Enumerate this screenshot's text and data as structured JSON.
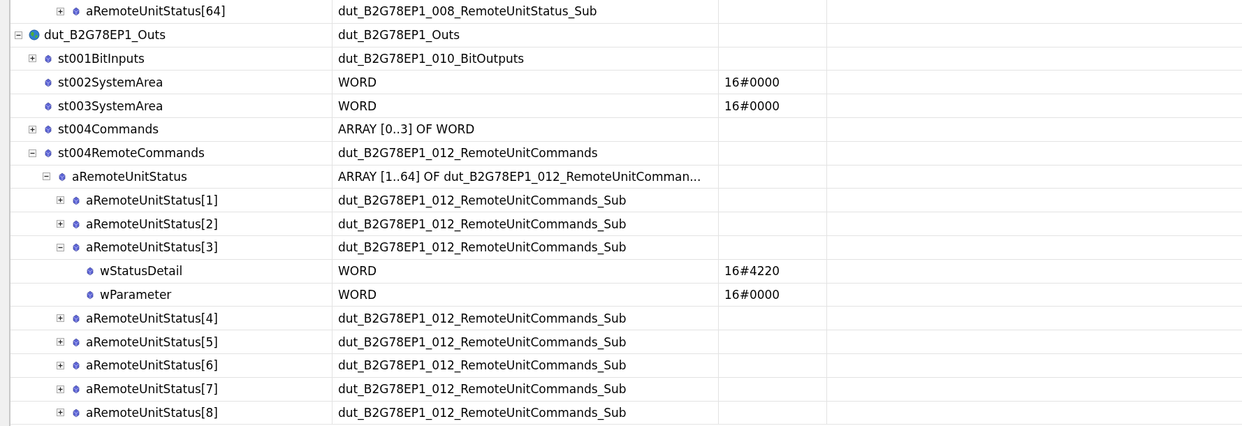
{
  "top_row": {
    "kind": "member",
    "name": "aRemoteUnitStatus[64]",
    "type": "dut_B2G78EP1_008_RemoteUnitStatus_Sub",
    "expanded": false
  },
  "tree": [
    {
      "kind": "root",
      "name": "dut_B2G78EP1_Outs",
      "type": "dut_B2G78EP1_Outs",
      "expanded": true,
      "children": [
        {
          "kind": "member",
          "name": "st001BitInputs",
          "type": "dut_B2G78EP1_010_BitOutputs",
          "expanded": false
        },
        {
          "kind": "member",
          "name": "st002SystemArea",
          "type": "WORD",
          "column_3": "16#0000"
        },
        {
          "kind": "member",
          "name": "st003SystemArea",
          "type": "WORD",
          "column_3": "16#0000"
        },
        {
          "kind": "member",
          "name": "st004Commands",
          "type": "ARRAY [0..3] OF WORD",
          "expanded": false
        },
        {
          "kind": "member",
          "name": "st004RemoteCommands",
          "type": "dut_B2G78EP1_012_RemoteUnitCommands",
          "expanded": true,
          "children": [
            {
              "kind": "member",
              "name": "aRemoteUnitStatus",
              "type": "ARRAY [1..64] OF dut_B2G78EP1_012_RemoteUnitComman...",
              "expanded": true,
              "children": [
                {
                  "kind": "member",
                  "name": "aRemoteUnitStatus[1]",
                  "type": "dut_B2G78EP1_012_RemoteUnitCommands_Sub",
                  "expanded": false
                },
                {
                  "kind": "member",
                  "name": "aRemoteUnitStatus[2]",
                  "type": "dut_B2G78EP1_012_RemoteUnitCommands_Sub",
                  "expanded": false
                },
                {
                  "kind": "member",
                  "name": "aRemoteUnitStatus[3]",
                  "type": "dut_B2G78EP1_012_RemoteUnitCommands_Sub",
                  "expanded": true,
                  "children": [
                    {
                      "kind": "member",
                      "name": "wStatusDetail",
                      "type": "WORD",
                      "column_3": "16#4220"
                    },
                    {
                      "kind": "member",
                      "name": "wParameter",
                      "type": "WORD",
                      "column_3": "16#0000"
                    }
                  ]
                },
                {
                  "kind": "member",
                  "name": "aRemoteUnitStatus[4]",
                  "type": "dut_B2G78EP1_012_RemoteUnitCommands_Sub",
                  "expanded": false
                },
                {
                  "kind": "member",
                  "name": "aRemoteUnitStatus[5]",
                  "type": "dut_B2G78EP1_012_RemoteUnitCommands_Sub",
                  "expanded": false
                },
                {
                  "kind": "member",
                  "name": "aRemoteUnitStatus[6]",
                  "type": "dut_B2G78EP1_012_RemoteUnitCommands_Sub",
                  "expanded": false
                },
                {
                  "kind": "member",
                  "name": "aRemoteUnitStatus[7]",
                  "type": "dut_B2G78EP1_012_RemoteUnitCommands_Sub",
                  "expanded": false
                },
                {
                  "kind": "member",
                  "name": "aRemoteUnitStatus[8]",
                  "type": "dut_B2G78EP1_012_RemoteUnitCommands_Sub",
                  "expanded": false
                }
              ]
            }
          ]
        }
      ]
    }
  ]
}
